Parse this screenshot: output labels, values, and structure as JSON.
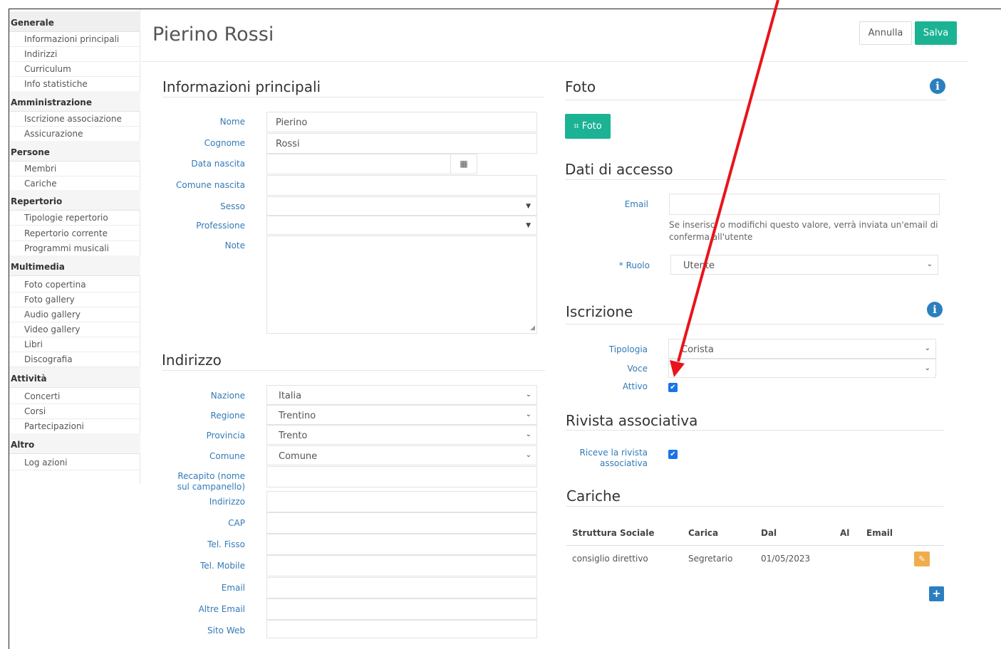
{
  "sidebar": {
    "generale": {
      "title": "Generale",
      "items": [
        "Informazioni principali",
        "Indirizzi",
        "Curriculum",
        "Info statistiche"
      ]
    },
    "amministrazione": {
      "title": "Amministrazione",
      "items": [
        "Iscrizione associazione",
        "Assicurazione"
      ]
    },
    "persone": {
      "title": "Persone",
      "items": [
        "Membri",
        "Cariche"
      ]
    },
    "repertorio": {
      "title": "Repertorio",
      "items": [
        "Tipologie repertorio",
        "Repertorio corrente",
        "Programmi musicali"
      ]
    },
    "multimedia": {
      "title": "Multimedia",
      "items": [
        "Foto copertina",
        "Foto gallery",
        "Audio gallery",
        "Video gallery",
        "Libri",
        "Discografia"
      ]
    },
    "attivita": {
      "title": "Attività",
      "items": [
        "Concerti",
        "Corsi",
        "Partecipazioni"
      ]
    },
    "altro": {
      "title": "Altro",
      "items": [
        "Log azioni"
      ]
    }
  },
  "header": {
    "title": "Pierino Rossi",
    "cancel_label": "Annulla",
    "save_label": "Salva"
  },
  "info": {
    "title": "Informazioni principali",
    "nome_label": "Nome",
    "nome_value": "Pierino",
    "cognome_label": "Cognome",
    "cognome_value": "Rossi",
    "data_nascita_label": "Data nascita",
    "comune_nascita_label": "Comune nascita",
    "sesso_label": "Sesso",
    "professione_label": "Professione",
    "note_label": "Note"
  },
  "indirizzo": {
    "title": "Indirizzo",
    "nazione_label": "Nazione",
    "nazione_value": "Italia",
    "regione_label": "Regione",
    "regione_value": "Trentino",
    "provincia_label": "Provincia",
    "provincia_value": "Trento",
    "comune_label": "Comune",
    "comune_value": "Comune",
    "recapito_label_1": "Recapito (nome",
    "recapito_label_2": "sul campanello)",
    "indirizzo_label": "Indirizzo",
    "cap_label": "CAP",
    "tel_fisso_label": "Tel. Fisso",
    "tel_mobile_label": "Tel. Mobile",
    "email_label": "Email",
    "altre_email_label": "Altre Email",
    "sito_web_label": "Sito Web"
  },
  "foto": {
    "title": "Foto",
    "button_label": "Foto",
    "info_glyph": "i"
  },
  "accesso": {
    "title": "Dati di accesso",
    "email_label": "Email",
    "email_help_1": "Se inserisci o modifichi questo valore, verrà inviata un'email di",
    "email_help_2": "conferma all'utente",
    "ruolo_label": "* Ruolo",
    "ruolo_value": "Utente"
  },
  "iscrizione": {
    "title": "Iscrizione",
    "info_glyph": "i",
    "tipologia_label": "Tipologia",
    "tipologia_value": "Corista",
    "voce_label": "Voce",
    "attivo_label": "Attivo"
  },
  "rivista": {
    "title": "Rivista associativa",
    "riceve_label_1": "Riceve la rivista",
    "riceve_label_2": "associativa"
  },
  "cariche": {
    "title": "Cariche",
    "columns": [
      "Struttura Sociale",
      "Carica",
      "Dal",
      "Al",
      "Email"
    ],
    "rows": [
      {
        "struttura": "consiglio direttivo",
        "carica": "Segretario",
        "dal": "01/05/2023"
      }
    ]
  },
  "colors": {
    "accent": "#1bb394",
    "info": "#2a7fbf",
    "edit": "#f0ad4e",
    "arrow": "#e8141b"
  },
  "icons": {
    "crop": "crop-icon",
    "calendar": "calendar-icon",
    "edit": "pencil-icon",
    "add": "plus-icon",
    "info": "info-icon"
  }
}
